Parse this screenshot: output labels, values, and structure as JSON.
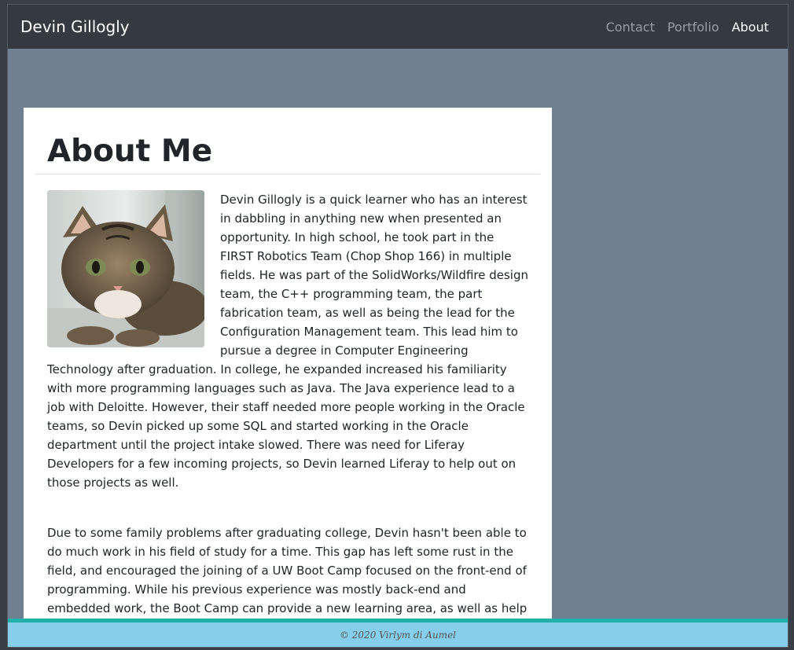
{
  "navbar": {
    "brand": "Devin Gillogly",
    "links": [
      {
        "label": "Contact",
        "active": false
      },
      {
        "label": "Portfolio",
        "active": false
      },
      {
        "label": "About",
        "active": true
      }
    ]
  },
  "main": {
    "title": "About Me",
    "paragraphs": [
      "Devin Gillogly is a quick learner who has an interest in dabbling in anything new when presented an opportunity. In high school, he took part in the FIRST Robotics Team (Chop Shop 166) in multiple fields. He was part of the SolidWorks/Wildfire design team, the C++ programming team, the part fabrication team, as well as being the lead for the Configuration Management team. This lead him to pursue a degree in Computer Engineering Technology after graduation. In college, he expanded increased his familiarity with more programming languages such as Java. The Java experience lead to a job with Deloitte. However, their staff needed more people working in the Oracle teams, so Devin picked up some SQL and started working in the Oracle department until the project intake slowed. There was need for Liferay Developers for a few incoming projects, so Devin learned Liferay to help out on those projects as well.",
      "Due to some family problems after graduating college, Devin hasn't been able to do much work in his field of study for a time. This gap has left some rust in the field, and encouraged the joining of a UW Boot Camp focused on the front-end of programming. While his previous experience was mostly back-end and embedded work, the Boot Camp can provide a new learning area, as well as help dust the rust off the back-end knowledge."
    ]
  },
  "footer": {
    "text": "© 2020 Virlym di Aumel"
  },
  "colors": {
    "navbar": "#343a40",
    "page_bg": "#708090",
    "footer_bg": "#87ceeb",
    "footer_border": "#20b2aa"
  }
}
